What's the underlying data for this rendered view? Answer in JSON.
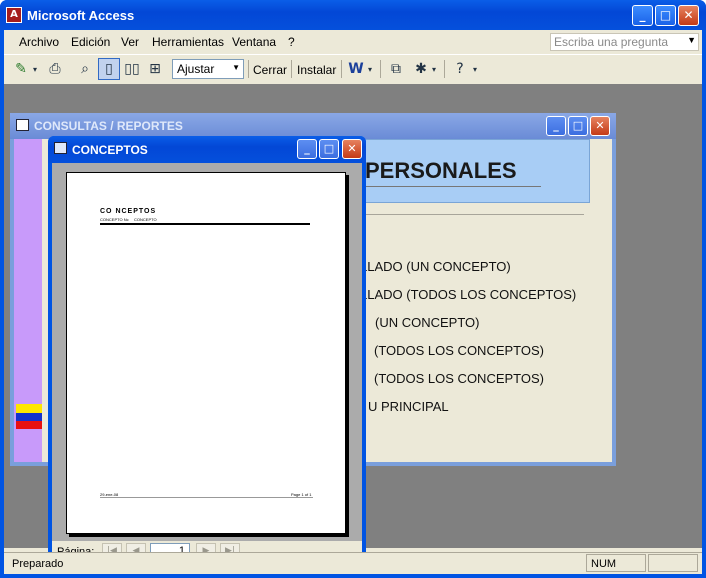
{
  "app": {
    "title": "Microsoft Access",
    "icon": "access-key-icon"
  },
  "title_buttons": {
    "minimize": "_",
    "maximize": "□",
    "close": "✕"
  },
  "menubar": {
    "items": [
      "Archivo",
      "Edición",
      "Ver",
      "Herramientas",
      "Ventana",
      "?"
    ],
    "help_placeholder": "Escriba una pregunta"
  },
  "toolbar": {
    "zoom_value": "Ajustar",
    "close_label": "Cerrar",
    "setup_label": "Instalar"
  },
  "back_window": {
    "title": "CONSULTAS / REPORTES",
    "header": "PERSONALES",
    "options": [
      "LLADO (UN CONCEPTO)",
      "LLADO (TODOS LOS CONCEPTOS)",
      "(UN CONCEPTO)",
      "(TODOS LOS CONCEPTOS)",
      "(TODOS LOS CONCEPTOS)",
      "U PRINCIPAL"
    ],
    "flag_colors": [
      "#ffe600",
      "#1432cc",
      "#e81010"
    ]
  },
  "front_window": {
    "title": "CONCEPTOS",
    "page": {
      "title": "CO NCEPTOS",
      "sub1": "CONCEPTO Nc",
      "sub2": "CONCEPTO",
      "footer_left": "29-ene-08",
      "footer_right": "Page 1 of 1"
    },
    "nav": {
      "label": "Página:",
      "page": "1"
    }
  },
  "status": {
    "text": "Preparado",
    "num": "NUM"
  }
}
